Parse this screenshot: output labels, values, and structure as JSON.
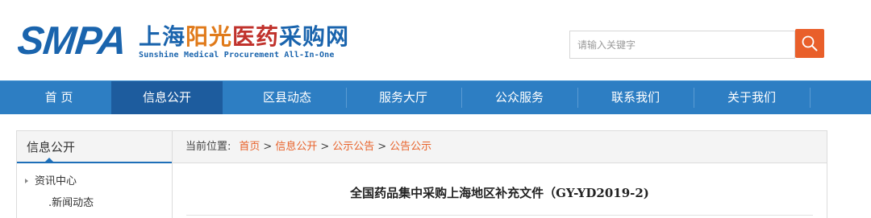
{
  "header": {
    "logo_mark": "SMPA",
    "logo_cn": {
      "part1": "上海",
      "part2": "阳光",
      "part3": "医药",
      "part4": "采购网"
    },
    "logo_en": "Sunshine Medical Procurement All-In-One",
    "search": {
      "placeholder": "请输入关键字",
      "value": ""
    },
    "search_button_icon": "search-icon"
  },
  "nav": {
    "items": [
      {
        "label": "首 页",
        "active": false
      },
      {
        "label": "信息公开",
        "active": true
      },
      {
        "label": "区县动态",
        "active": false
      },
      {
        "label": "服务大厅",
        "active": false
      },
      {
        "label": "公众服务",
        "active": false
      },
      {
        "label": "联系我们",
        "active": false
      },
      {
        "label": "关于我们",
        "active": false
      }
    ]
  },
  "sidebar": {
    "title": "信息公开",
    "groups": [
      {
        "label": "资讯中心",
        "children": [
          ".新闻动态"
        ]
      }
    ]
  },
  "breadcrumb": {
    "label": "当前位置:",
    "items": [
      "首页",
      "信息公开",
      "公示公告",
      "公告公示"
    ],
    "separator": ">"
  },
  "article": {
    "title": "全国药品集中采购上海地区补充文件（GY-YD2019-2)"
  },
  "colors": {
    "brand_blue": "#1a64ad",
    "nav_blue": "#2d7ec3",
    "nav_active": "#1d5c9e",
    "accent_orange": "#e95f2a",
    "link_orange": "#e8622a"
  }
}
